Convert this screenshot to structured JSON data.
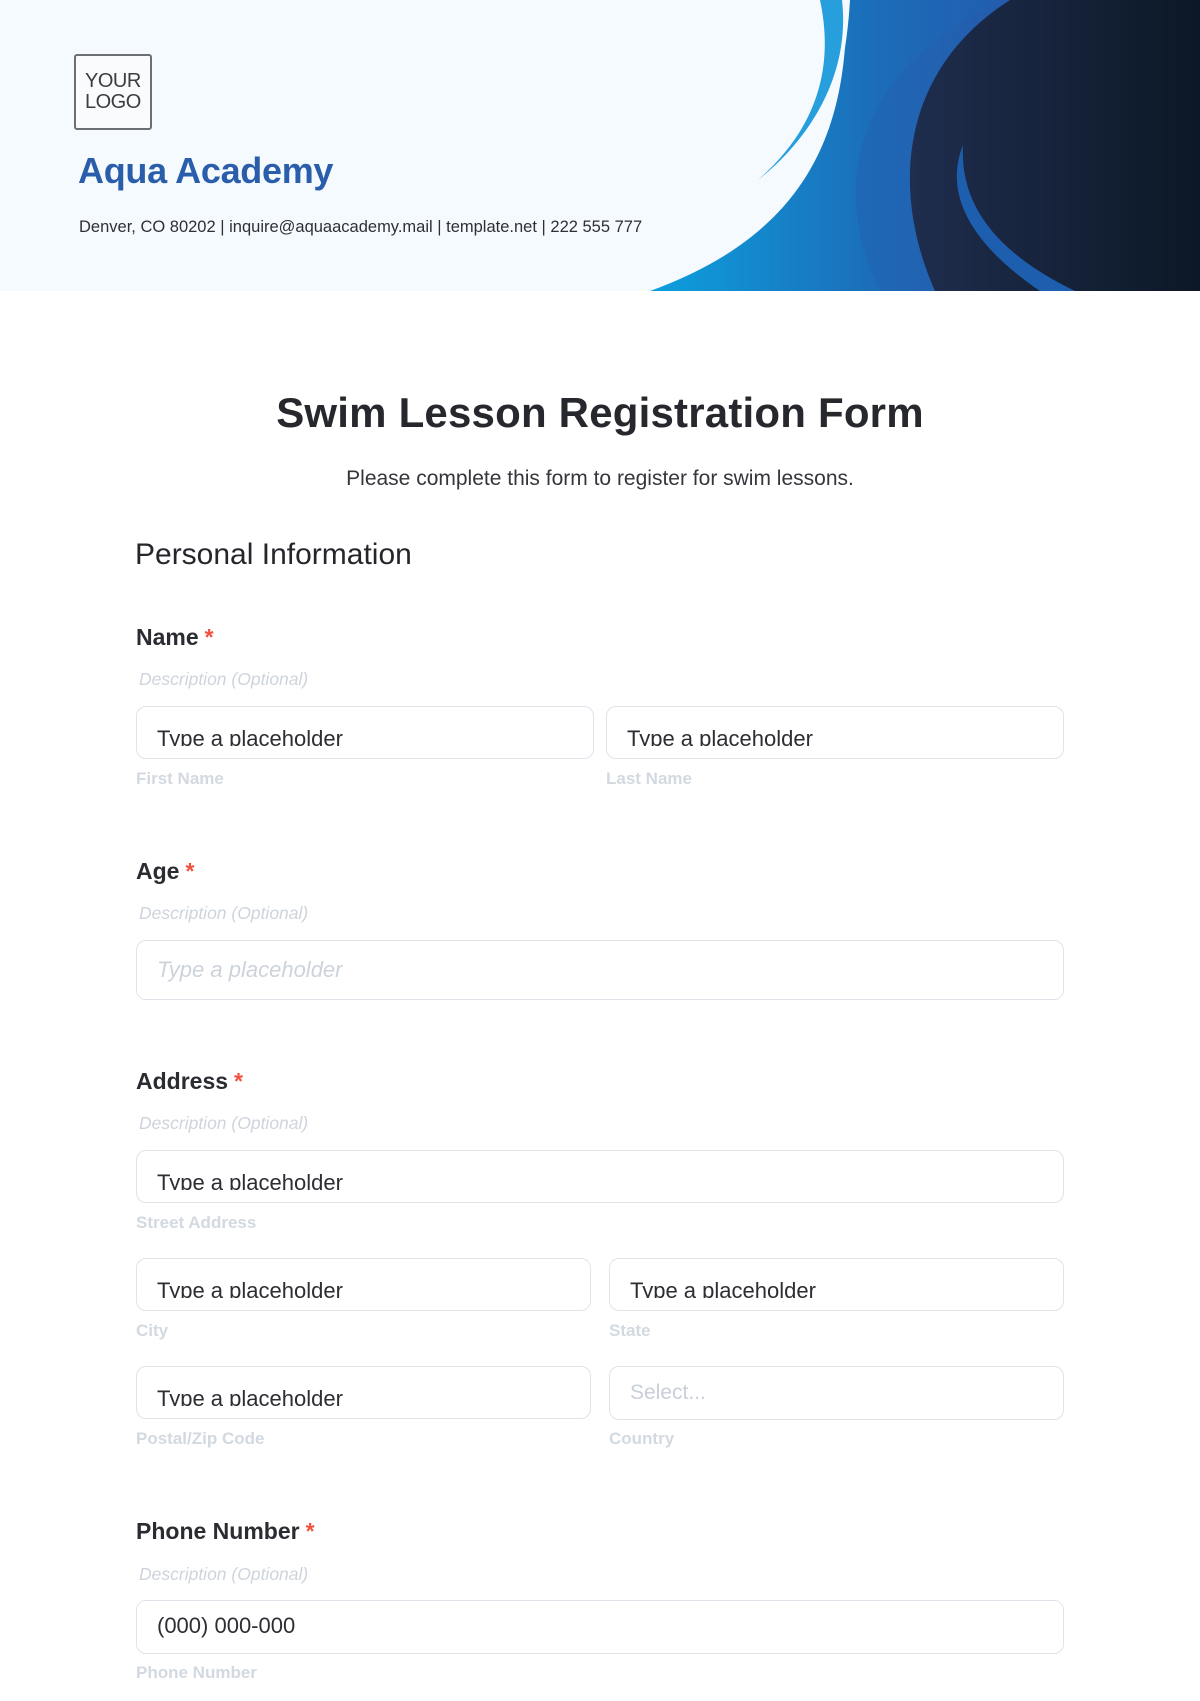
{
  "header": {
    "logo_line1": "YOUR",
    "logo_line2": "LOGO",
    "organization": "Aqua Academy",
    "contact": "Denver, CO 80202 | inquire@aquaacademy.mail | template.net | 222 555 777",
    "colors": {
      "background": "#f5faff",
      "brand_text": "#2a5daa",
      "wave_light": "#279fdc",
      "wave_mid": "#1d5fae",
      "wave_dark": "#1b2a48"
    }
  },
  "form": {
    "title": "Swim Lesson Registration Form",
    "subtitle": "Please complete this form to register for swim lessons.",
    "section": "Personal Information",
    "required_marker": "*",
    "fields": {
      "name": {
        "label": "Name",
        "description": "Description (Optional)",
        "first": {
          "value": "Type a placeholder",
          "sublabel": "First Name"
        },
        "last": {
          "value": "Type a placeholder",
          "sublabel": "Last Name"
        }
      },
      "age": {
        "label": "Age",
        "description": "Description (Optional)",
        "placeholder": "Type a placeholder"
      },
      "address": {
        "label": "Address",
        "description": "Description (Optional)",
        "street": {
          "value": "Type a placeholder",
          "sublabel": "Street Address"
        },
        "city": {
          "value": "Type a placeholder",
          "sublabel": "City"
        },
        "state": {
          "value": "Type a placeholder",
          "sublabel": "State"
        },
        "postal": {
          "value": "Type a placeholder",
          "sublabel": "Postal/Zip Code"
        },
        "country": {
          "value": "Select...",
          "sublabel": "Country"
        }
      },
      "phone": {
        "label": "Phone Number",
        "description": "Description (Optional)",
        "value": "(000) 000-000",
        "sublabel": "Phone Number"
      }
    }
  }
}
